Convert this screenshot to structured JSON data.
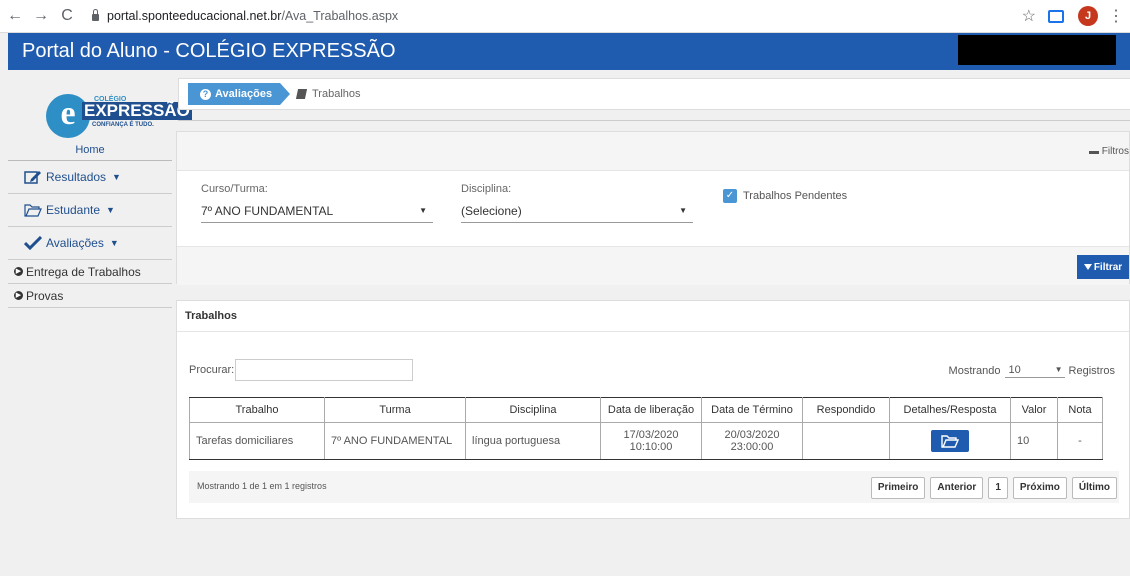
{
  "browser": {
    "back": "←",
    "forward": "→",
    "reload": "C",
    "url_host": "portal.sponteeducacional.net.br",
    "url_path": "/Ava_Trabalhos.aspx",
    "profile_initial": "J"
  },
  "header": {
    "title": "Portal do Aluno - COLÉGIO EXPRESSÃO"
  },
  "logo": {
    "top": "COLÉGIO",
    "main": "EXPRESSÃO",
    "tagline": "CONFIANÇA É TUDO.",
    "letter": "e"
  },
  "sidebar": {
    "home": "Home",
    "items": [
      {
        "label": "Resultados"
      },
      {
        "label": "Estudante"
      },
      {
        "label": "Avaliações"
      }
    ],
    "subitems": [
      {
        "label": "Entrega de Trabalhos"
      },
      {
        "label": "Provas"
      }
    ]
  },
  "breadcrumb": {
    "active": "Avaliações",
    "current": "Trabalhos"
  },
  "filters": {
    "toggle": "Filtros",
    "curso_label": "Curso/Turma:",
    "curso_value": "7º ANO FUNDAMENTAL",
    "disciplina_label": "Disciplina:",
    "disciplina_value": "(Selecione)",
    "pendentes_label": "Trabalhos Pendentes",
    "filtrar_button": "Filtrar"
  },
  "trabalhos": {
    "title": "Trabalhos",
    "search_label": "Procurar:",
    "mostrando_label": "Mostrando",
    "page_size": "10",
    "registros_label": "Registros",
    "columns": [
      "Trabalho",
      "Turma",
      "Disciplina",
      "Data de liberação",
      "Data de Término",
      "Respondido",
      "Detalhes/Resposta",
      "Valor",
      "Nota"
    ],
    "rows": [
      {
        "trabalho": "Tarefas domiciliares",
        "turma": "7º ANO FUNDAMENTAL",
        "disciplina": "língua portuguesa",
        "liberacao_date": "17/03/2020",
        "liberacao_time": "10:10:00",
        "termino_date": "20/03/2020",
        "termino_time": "23:00:00",
        "respondido": "",
        "valor": "10",
        "nota": "-"
      }
    ],
    "footer_info": "Mostrando 1 de 1 em 1 registros",
    "pager": {
      "first": "Primeiro",
      "prev": "Anterior",
      "page": "1",
      "next": "Próximo",
      "last": "Último"
    }
  }
}
